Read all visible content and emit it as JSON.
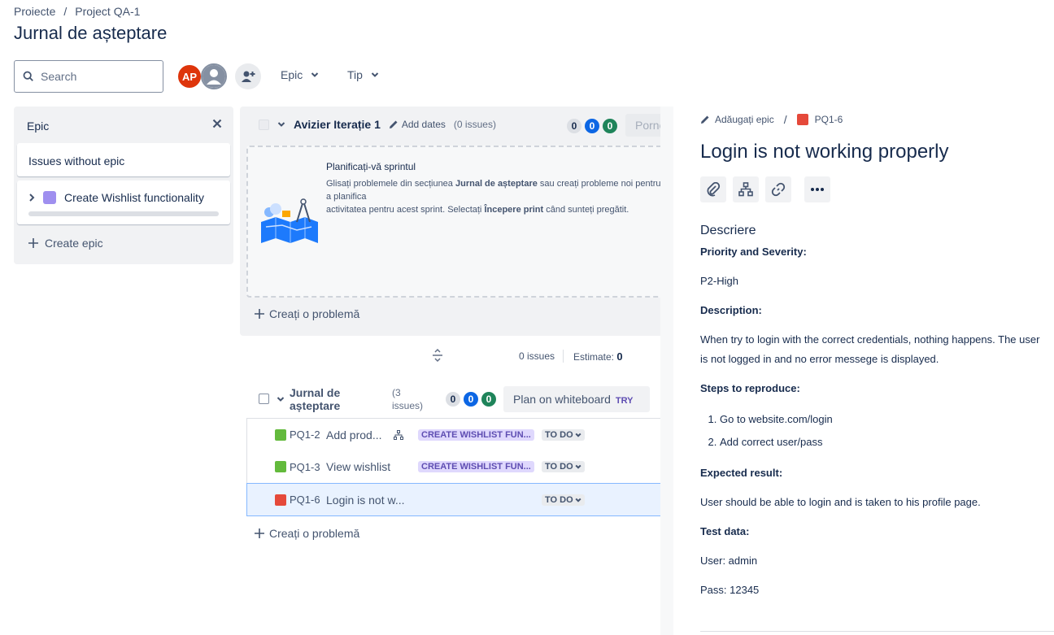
{
  "breadcrumb": {
    "item1": "Proiecte",
    "separator": "/",
    "item2": "Project QA-1"
  },
  "page_title": "Jurnal de așteptare",
  "toolbar": {
    "search_placeholder": "Search",
    "avatar_initials": "AP",
    "filter_epic": "Epic",
    "filter_type": "Tip"
  },
  "epic_panel": {
    "title": "Epic",
    "issues_without_epic": "Issues without epic",
    "epic_name": "Create Wishlist functionality",
    "create_epic": "Create epic"
  },
  "sprint": {
    "name": "Avizier Iterație 1",
    "add_dates": "Add dates",
    "issue_count": "(0 issues)",
    "counts": [
      "0",
      "0",
      "0"
    ],
    "start_button": "Porne",
    "plan_title": "Planificați-vă sprintul",
    "plan_desc_1": "Glisați problemele din secțiunea ",
    "plan_desc_bold_1": "Jurnal de așteptare",
    "plan_desc_2": " sau creați probleme noi pentru a planifica",
    "plan_desc_3": "activitatea pentru acest sprint. Selectați ",
    "plan_desc_bold_2": "Începere print",
    "plan_desc_4": " când sunteți pregătit.",
    "create_issue": "Creați o problemă"
  },
  "sprint_summary": {
    "issues": "0 issues",
    "estimate_label": "Estimate:",
    "estimate_value": "0"
  },
  "backlog": {
    "name": "Jurnal de așteptare",
    "issue_count": "(3 issues)",
    "counts": [
      "0",
      "0",
      "0"
    ],
    "whiteboard_button": "Plan on whiteboard",
    "whiteboard_badge": "TRY",
    "create_issue": "Creați o problemă",
    "issues": [
      {
        "key": "PQ1-2",
        "summary": "Add prod...",
        "epic": "CREATE WISHLIST FUN...",
        "status": "TO DO",
        "type": "story"
      },
      {
        "key": "PQ1-3",
        "summary": "View wishlist",
        "epic": "CREATE WISHLIST FUN...",
        "status": "TO DO",
        "type": "story"
      },
      {
        "key": "PQ1-6",
        "summary": "Login is not w...",
        "epic": "",
        "status": "TO DO",
        "type": "bug"
      }
    ]
  },
  "detail": {
    "add_epic": "Adăugați epic",
    "separator": "/",
    "issue_key": "PQ1-6",
    "title": "Login is not working properly",
    "description_heading": "Descriere",
    "priority_label": "Priority and Severity:",
    "priority_value": "P2-High",
    "description_label": "Description:",
    "description_value": "When try to login with the correct credentials, nothing happens. The user is not logged in and no error messege is displayed.",
    "steps_label": "Steps to reproduce:",
    "steps": [
      "Go to website.com/login",
      "Add correct user/pass"
    ],
    "expected_label": "Expected result:",
    "expected_value": "User should be able to login and is taken to his profile page.",
    "test_data_label": "Test data:",
    "test_user": "User: admin",
    "test_pass": "Pass: 12345"
  },
  "colors": {
    "primary_text": "#172b4d",
    "secondary_text": "#44546f",
    "panel_bg": "#f1f2f4",
    "blue": "#0c66e4",
    "green": "#1f845a",
    "epic_purple": "#9f8fef",
    "bug_red": "#e5493a",
    "story_green": "#63ba3c",
    "avatar_red": "#de350b"
  }
}
